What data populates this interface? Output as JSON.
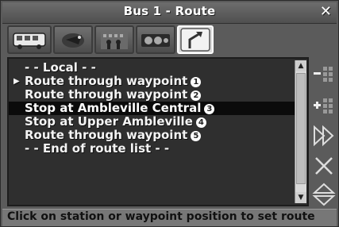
{
  "window": {
    "title": "Bus 1 - Route"
  },
  "tabs": [
    {
      "name": "bus"
    },
    {
      "name": "bird"
    },
    {
      "name": "people"
    },
    {
      "name": "camera"
    },
    {
      "name": "route-arrow"
    }
  ],
  "route_list": {
    "rows": [
      {
        "text": "- - Local - -",
        "badge": ""
      },
      {
        "text": "Route through waypoint",
        "badge": "1"
      },
      {
        "text": "Route through waypoint",
        "badge": "2"
      },
      {
        "text": "Stop at Ambleville Central",
        "badge": "3"
      },
      {
        "text": "Stop at Upper Ambleville",
        "badge": "4"
      },
      {
        "text": "Route through waypoint",
        "badge": "5"
      },
      {
        "text": "- - End of route list - -",
        "badge": ""
      }
    ]
  },
  "status": {
    "text": "Click on station or waypoint position to set route"
  }
}
